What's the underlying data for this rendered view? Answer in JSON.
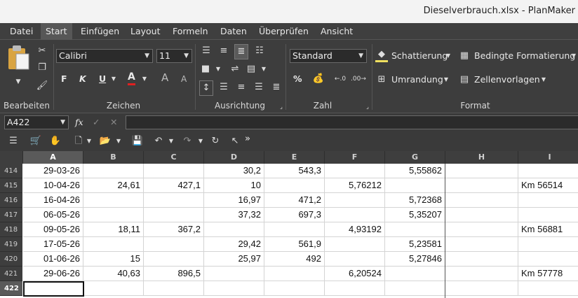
{
  "window": {
    "title": "Dieselverbrauch.xlsx - PlanMaker"
  },
  "menu": [
    "Datei",
    "Start",
    "Einfügen",
    "Layout",
    "Formeln",
    "Daten",
    "Überprüfen",
    "Ansicht"
  ],
  "ribbon": {
    "groups": {
      "edit": "Bearbeiten",
      "font": "Zeichen",
      "align": "Ausrichtung",
      "number": "Zahl",
      "format": "Format"
    },
    "font_name": "Calibri",
    "font_size": "11",
    "number_format": "Standard",
    "bold": "F",
    "italic": "K",
    "underline": "U",
    "font_color": "A",
    "grow_font": "A",
    "shrink_font": "A",
    "percent": "%",
    "shading": "Schattierung",
    "conditional": "Bedingte Formatierung",
    "border": "Umrandung",
    "cell_styles": "Zellenvorlagen",
    "colors": {
      "font_color": "#e02020",
      "shading": "#f0e060"
    }
  },
  "formula_bar": {
    "cell_ref": "A422",
    "fx": "fx",
    "check": "✓",
    "cancel": "✕",
    "content": ""
  },
  "quickbar": {
    "more": "»"
  },
  "sheet": {
    "columns": [
      "A",
      "B",
      "C",
      "D",
      "E",
      "F",
      "G",
      "H",
      "I"
    ],
    "selected_column": "A",
    "selected_row": "422",
    "active_cell": "A422",
    "rows": [
      {
        "num": "414",
        "cells": [
          "29-03-26",
          "",
          "",
          "30,2",
          "543,3",
          "",
          "5,55862",
          "",
          ""
        ]
      },
      {
        "num": "415",
        "cells": [
          "10-04-26",
          "24,61",
          "427,1",
          "10",
          "",
          "5,76212",
          "",
          "",
          "Km 56514"
        ]
      },
      {
        "num": "416",
        "cells": [
          "16-04-26",
          "",
          "",
          "16,97",
          "471,2",
          "",
          "5,72368",
          "",
          ""
        ]
      },
      {
        "num": "417",
        "cells": [
          "06-05-26",
          "",
          "",
          "37,32",
          "697,3",
          "",
          "5,35207",
          "",
          ""
        ]
      },
      {
        "num": "418",
        "cells": [
          "09-05-26",
          "18,11",
          "367,2",
          "",
          "",
          "4,93192",
          "",
          "",
          "Km 56881"
        ]
      },
      {
        "num": "419",
        "cells": [
          "17-05-26",
          "",
          "",
          "29,42",
          "561,9",
          "",
          "5,23581",
          "",
          ""
        ]
      },
      {
        "num": "420",
        "cells": [
          "01-06-26",
          "15",
          "",
          "25,97",
          "492",
          "",
          "5,27846",
          "",
          ""
        ]
      },
      {
        "num": "421",
        "cells": [
          "29-06-26",
          "40,63",
          "896,5",
          "",
          "",
          "6,20524",
          "",
          "",
          "Km 57778"
        ]
      },
      {
        "num": "422",
        "cells": [
          "",
          "",
          "",
          "",
          "",
          "",
          "",
          "",
          ""
        ]
      }
    ]
  }
}
